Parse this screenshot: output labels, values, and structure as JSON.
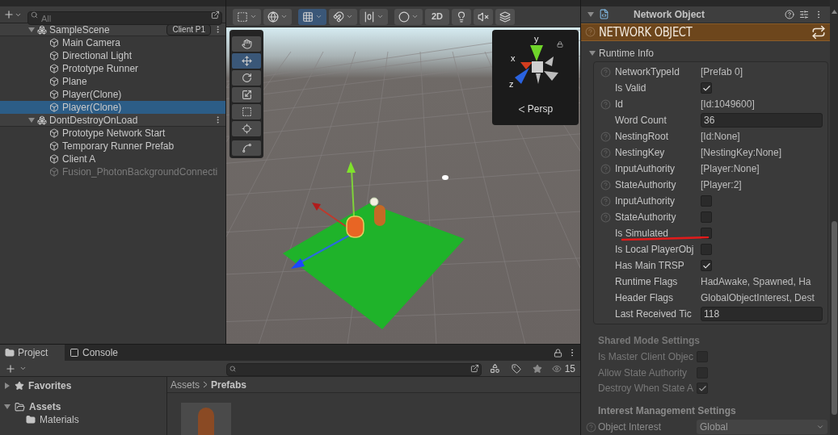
{
  "hierarchy": {
    "search": {
      "placeholder": "All"
    },
    "scenes": [
      {
        "name": "SampleScene",
        "badge": "Client P1",
        "expanded": true,
        "children": [
          {
            "name": "Main Camera",
            "selected": false,
            "disabled": false
          },
          {
            "name": "Directional Light",
            "selected": false,
            "disabled": false
          },
          {
            "name": "Prototype Runner",
            "selected": false,
            "disabled": false
          },
          {
            "name": "Plane",
            "selected": false,
            "disabled": false
          },
          {
            "name": "Player(Clone)",
            "selected": false,
            "disabled": false
          },
          {
            "name": "Player(Clone)",
            "selected": true,
            "disabled": false
          }
        ]
      },
      {
        "name": "DontDestroyOnLoad",
        "expanded": true,
        "children": [
          {
            "name": "Prototype Network Start",
            "selected": false,
            "disabled": false
          },
          {
            "name": "Temporary Runner Prefab",
            "selected": false,
            "disabled": false
          },
          {
            "name": "Client A",
            "selected": false,
            "disabled": false
          },
          {
            "name": "Fusion_PhotonBackgroundConnecti",
            "selected": false,
            "disabled": true
          }
        ]
      }
    ]
  },
  "scene_view": {
    "toolbar": [
      {
        "kind": "icon",
        "selected": false
      },
      {
        "kind": "icon",
        "selected": false
      },
      {
        "kind": "icon",
        "selected": true
      },
      {
        "kind": "icon",
        "selected": false
      },
      {
        "kind": "icon",
        "selected": false
      },
      {
        "kind": "icon",
        "selected": false
      },
      {
        "kind": "text",
        "label": "2D",
        "selected": false
      },
      {
        "kind": "icon",
        "selected": false
      },
      {
        "kind": "icon",
        "selected": false
      },
      {
        "kind": "icon",
        "selected": false
      }
    ],
    "tools": [
      {
        "selected": false
      },
      {
        "selected": true
      },
      {
        "selected": false
      },
      {
        "selected": false
      },
      {
        "selected": false
      },
      {
        "selected": false
      },
      {
        "selected": false
      }
    ],
    "gizmo": {
      "axes": [
        "x",
        "y",
        "z"
      ],
      "projection": "Persp"
    }
  },
  "inspector": {
    "component": {
      "title": "Network Object",
      "expanded": true
    },
    "banner": "NETWORK OBJECT",
    "runtime_info": {
      "title": "Runtime Info",
      "expanded": true,
      "fields": [
        {
          "label": "NetworkTypeId",
          "help": true,
          "kind": "text",
          "value": "[Prefab 0]",
          "underlined": false
        },
        {
          "label": "Is Valid",
          "help": false,
          "kind": "checkbox",
          "checked": true,
          "underlined": false
        },
        {
          "label": "Id",
          "help": true,
          "kind": "text",
          "value": "[Id:1049600]",
          "underlined": false
        },
        {
          "label": "Word Count",
          "help": false,
          "kind": "input",
          "value": "36",
          "underlined": false
        },
        {
          "label": "NestingRoot",
          "help": true,
          "kind": "text",
          "value": "[Id:None]",
          "underlined": false
        },
        {
          "label": "NestingKey",
          "help": true,
          "kind": "text",
          "value": "[NestingKey:None]",
          "underlined": false
        },
        {
          "label": "InputAuthority",
          "help": true,
          "kind": "text",
          "value": "[Player:None]",
          "underlined": false
        },
        {
          "label": "StateAuthority",
          "help": true,
          "kind": "text",
          "value": "[Player:2]",
          "underlined": false
        },
        {
          "label": "InputAuthority",
          "help": true,
          "kind": "checkbox",
          "checked": false,
          "underlined": false
        },
        {
          "label": "StateAuthority",
          "help": true,
          "kind": "checkbox",
          "checked": false,
          "underlined": false
        },
        {
          "label": "Is Simulated",
          "help": false,
          "kind": "checkbox",
          "checked": false,
          "underlined": true
        },
        {
          "label": "Is Local PlayerObj",
          "help": false,
          "kind": "checkbox",
          "checked": false,
          "underlined": false
        },
        {
          "label": "Has Main TRSP",
          "help": false,
          "kind": "checkbox",
          "checked": true,
          "underlined": false
        },
        {
          "label": "Runtime Flags",
          "help": false,
          "kind": "text",
          "value": "HadAwake, Spawned, Ha",
          "underlined": false
        },
        {
          "label": "Header Flags",
          "help": false,
          "kind": "text",
          "value": "GlobalObjectInterest, Dest",
          "underlined": false
        },
        {
          "label": "Last Received Tic",
          "help": false,
          "kind": "input",
          "value": "118",
          "underlined": false
        }
      ]
    },
    "shared_mode": {
      "title": "Shared Mode Settings",
      "disabled": true,
      "fields": [
        {
          "label": "Is Master Client Objec",
          "checked": false
        },
        {
          "label": "Allow State Authority",
          "checked": false
        },
        {
          "label": "Destroy When State A",
          "checked": true
        }
      ]
    },
    "interest": {
      "title": "Interest Management Settings",
      "fields": [
        {
          "label": "Object Interest",
          "value": "Global"
        }
      ]
    }
  },
  "project": {
    "tabs": [
      {
        "label": "Project",
        "selected": true
      },
      {
        "label": "Console",
        "selected": false
      }
    ],
    "visible_count": "15",
    "sidebar": [
      {
        "label": "Favorites",
        "expanded": false
      },
      {
        "label": "Assets",
        "expanded": true,
        "children": [
          {
            "label": "Materials"
          }
        ]
      }
    ],
    "breadcrumb": [
      "Assets",
      "Prefabs"
    ]
  }
}
